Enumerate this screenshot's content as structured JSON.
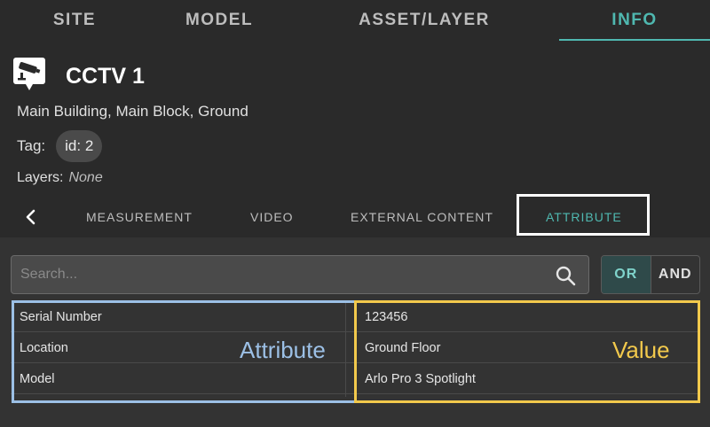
{
  "top_tabs": [
    {
      "label": "SITE",
      "active": false
    },
    {
      "label": "MODEL",
      "active": false
    },
    {
      "label": "ASSET/LAYER",
      "active": false
    },
    {
      "label": "INFO",
      "active": true
    }
  ],
  "asset": {
    "icon": "cctv-camera-icon",
    "title": "CCTV 1",
    "path": "Main Building, Main Block, Ground",
    "tag_label": "Tag:",
    "tag_value": "id: 2",
    "layers_label": "Layers:",
    "layers_value": "None"
  },
  "sub_tabs": [
    {
      "label": "MEASUREMENT",
      "active": false
    },
    {
      "label": "VIDEO",
      "active": false
    },
    {
      "label": "EXTERNAL CONTENT",
      "active": false
    },
    {
      "label": "ATTRIBUTE",
      "active": true
    }
  ],
  "search": {
    "placeholder": "Search...",
    "value": ""
  },
  "filter_toggle": {
    "or_label": "OR",
    "and_label": "AND",
    "selected": "OR"
  },
  "attributes": [
    {
      "attribute": "Serial Number",
      "value": "123456"
    },
    {
      "attribute": "Location",
      "value": "Ground Floor"
    },
    {
      "attribute": "Model",
      "value": "Arlo Pro 3 Spotlight"
    }
  ],
  "annotations": {
    "attribute_label": "Attribute",
    "value_label": "Value"
  },
  "colors": {
    "accent": "#4fb8b0",
    "attribute_frame": "#9cc0e6",
    "value_frame": "#f2c94c",
    "background": "#2a2a2a"
  }
}
